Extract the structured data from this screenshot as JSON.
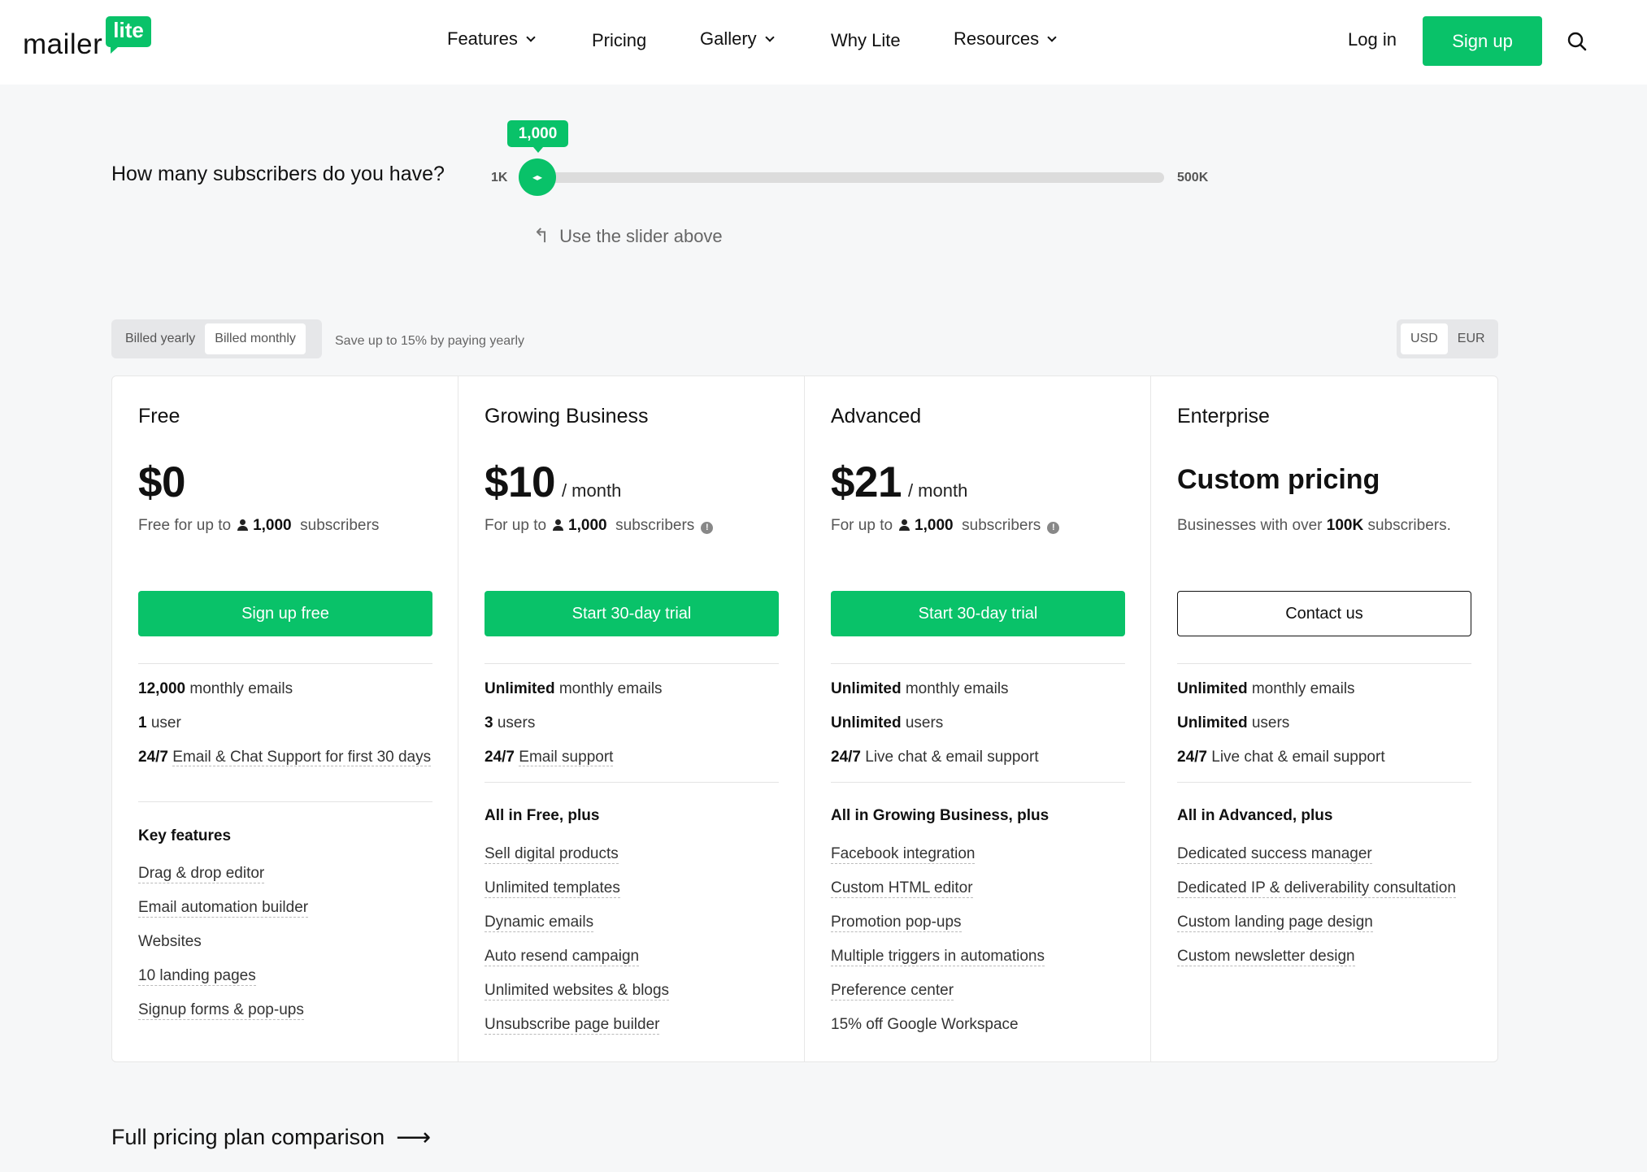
{
  "header": {
    "logo_word": "mailer",
    "logo_badge": "lite",
    "nav": [
      {
        "label": "Features",
        "has_dropdown": true
      },
      {
        "label": "Pricing",
        "has_dropdown": false
      },
      {
        "label": "Gallery",
        "has_dropdown": true
      },
      {
        "label": "Why Lite",
        "has_dropdown": false
      },
      {
        "label": "Resources",
        "has_dropdown": true
      }
    ],
    "login_label": "Log in",
    "signup_label": "Sign up",
    "search_icon": "search-icon"
  },
  "slider": {
    "question": "How many subscribers do you have?",
    "min_label": "1K",
    "max_label": "500K",
    "current_value": "1,000",
    "position_fraction": 0,
    "hint": "Use the slider above"
  },
  "billing": {
    "options": [
      "Billed yearly",
      "Billed monthly"
    ],
    "selected": "Billed monthly",
    "save_note": "Save up to 15% by paying yearly"
  },
  "currency": {
    "options": [
      "USD",
      "EUR"
    ],
    "selected": "USD"
  },
  "plans": [
    {
      "name": "Free",
      "price": "$0",
      "per": "",
      "sub_prefix": "Free for up to",
      "sub_count": "1,000",
      "sub_suffix": "subscribers",
      "button": "Sign up free",
      "limits": [
        {
          "bold": "12,000",
          "text": "monthly emails"
        },
        {
          "bold": "1",
          "text": "user"
        },
        {
          "bold": "24/7",
          "text": "Email & Chat Support for first 30 days"
        }
      ],
      "features_heading": "Key features",
      "features": [
        "Drag & drop editor",
        "Email automation builder",
        "Websites",
        "10 landing pages",
        "Signup forms & pop-ups"
      ]
    },
    {
      "name": "Growing Business",
      "price": "$10",
      "per": "/ month",
      "sub_prefix": "For up to",
      "sub_count": "1,000",
      "sub_suffix": "subscribers",
      "button": "Start 30-day trial",
      "limits": [
        {
          "bold": "Unlimited",
          "text": "monthly emails"
        },
        {
          "bold": "3",
          "text": "users"
        },
        {
          "bold": "24/7",
          "text": "Email support"
        }
      ],
      "features_heading": "All in Free, plus",
      "features": [
        "Sell digital products",
        "Unlimited templates",
        "Dynamic emails",
        "Auto resend campaign",
        "Unlimited websites & blogs",
        "Unsubscribe page builder"
      ]
    },
    {
      "name": "Advanced",
      "price": "$21",
      "per": "/ month",
      "sub_prefix": "For up to",
      "sub_count": "1,000",
      "sub_suffix": "subscribers",
      "button": "Start 30-day trial",
      "limits": [
        {
          "bold": "Unlimited",
          "text": "monthly emails"
        },
        {
          "bold": "Unlimited",
          "text": "users"
        },
        {
          "bold": "24/7",
          "text": "Live chat & email support"
        }
      ],
      "features_heading": "All in Growing Business, plus",
      "features": [
        "Facebook integration",
        "Custom HTML editor",
        "Promotion pop-ups",
        "Multiple triggers in automations",
        "Preference center",
        "15% off Google Workspace"
      ]
    },
    {
      "name": "Enterprise",
      "price": "Custom pricing",
      "sub_prefix": "Businesses with over",
      "sub_count": "100K",
      "sub_suffix": "subscribers.",
      "button": "Contact us",
      "limits": [
        {
          "bold": "Unlimited",
          "text": "monthly emails"
        },
        {
          "bold": "Unlimited",
          "text": "users"
        },
        {
          "bold": "24/7",
          "text": "Live chat & email support"
        }
      ],
      "features_heading": "All in Advanced, plus",
      "features": [
        "Dedicated success manager",
        "Dedicated IP & deliverability consultation",
        "Custom landing page design",
        "Custom newsletter design"
      ]
    }
  ],
  "comparison_link": "Full pricing plan comparison",
  "colors": {
    "accent": "#09c269",
    "text": "#111111",
    "muted": "#555555",
    "background": "#f6f7f8"
  }
}
